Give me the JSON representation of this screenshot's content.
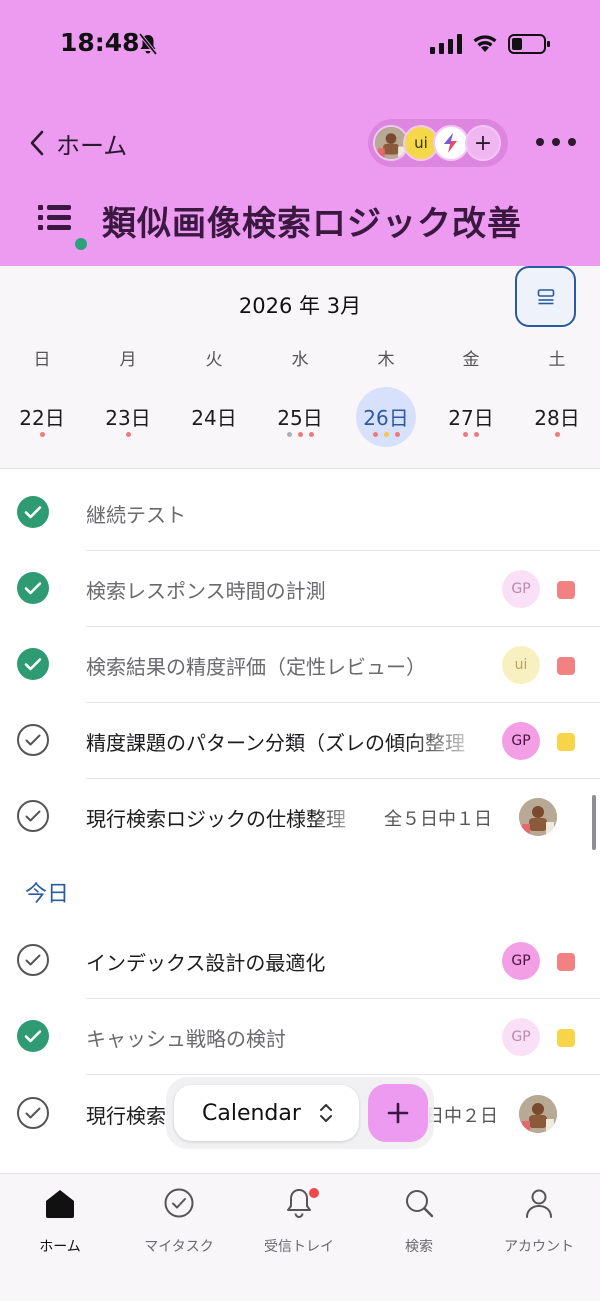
{
  "status_bar": {
    "time": "18:48"
  },
  "header": {
    "back_label": "ホーム",
    "members": [
      {
        "type": "photo"
      },
      {
        "initials": "ui"
      },
      {
        "type": "zap"
      }
    ],
    "add_member": "+",
    "project_title": "類似画像検索ロジック改善"
  },
  "calendar": {
    "month_label": "2026 年 3月",
    "weekdays": [
      "日",
      "月",
      "火",
      "水",
      "木",
      "金",
      "土"
    ],
    "days": [
      {
        "label": "22日",
        "dots": [
          "#f07a7a"
        ]
      },
      {
        "label": "23日",
        "dots": [
          "#f07a7a"
        ]
      },
      {
        "label": "24日",
        "dots": []
      },
      {
        "label": "25日",
        "dots": [
          "#b0b0b4",
          "#f07a7a",
          "#f07a7a"
        ]
      },
      {
        "label": "26日",
        "dots": [
          "#f07a7a",
          "#f5c94a",
          "#f07a7a"
        ],
        "selected": true
      },
      {
        "label": "27日",
        "dots": [
          "#f07a7a",
          "#f07a7a"
        ]
      },
      {
        "label": "28日",
        "dots": [
          "#f07a7a"
        ]
      }
    ],
    "selected_color": "#2c5aa0"
  },
  "tasks_before": [
    {
      "title": "継続テスト",
      "done": true
    },
    {
      "title": "検索レスポンス時間の計測",
      "done": true,
      "assignee": "GP",
      "priority_color": "#f28282"
    },
    {
      "title": "検索結果の精度評価（定性レビュー）",
      "done": true,
      "assignee": "ui",
      "priority_color": "#f28282"
    },
    {
      "title": "精度課題のパターン分類（ズレの傾向整理",
      "done": false,
      "assignee": "GP",
      "priority_color": "#f7d54a"
    },
    {
      "title": "現行検索ロジックの仕様整理",
      "done": false,
      "progress": "全５日中１日",
      "assignee": "photo"
    }
  ],
  "section_today": "今日",
  "tasks_today": [
    {
      "title": "インデックス設計の最適化",
      "done": false,
      "assignee": "GP",
      "priority_color": "#f28282"
    },
    {
      "title": "キャッシュ戦略の検討",
      "done": true,
      "assignee": "GP",
      "priority_color": "#f7d54a"
    },
    {
      "title": "現行検索",
      "done": false,
      "progress": "日中２日",
      "assignee": "photo"
    }
  ],
  "floating": {
    "view_label": "Calendar",
    "add_label": "+"
  },
  "tabbar": {
    "items": [
      {
        "label": "ホーム",
        "icon": "home-icon",
        "active": true
      },
      {
        "label": "マイタスク",
        "icon": "check-circle-icon"
      },
      {
        "label": "受信トレイ",
        "icon": "bell-icon",
        "badge": true
      },
      {
        "label": "検索",
        "icon": "search-icon"
      },
      {
        "label": "アカウント",
        "icon": "person-icon"
      }
    ]
  },
  "colors": {
    "header_bg": "#ec9bf0",
    "done_check": "#2f9b73",
    "link_blue": "#2c5aa0",
    "priority_red": "#f28282",
    "priority_yellow": "#f7d54a"
  }
}
